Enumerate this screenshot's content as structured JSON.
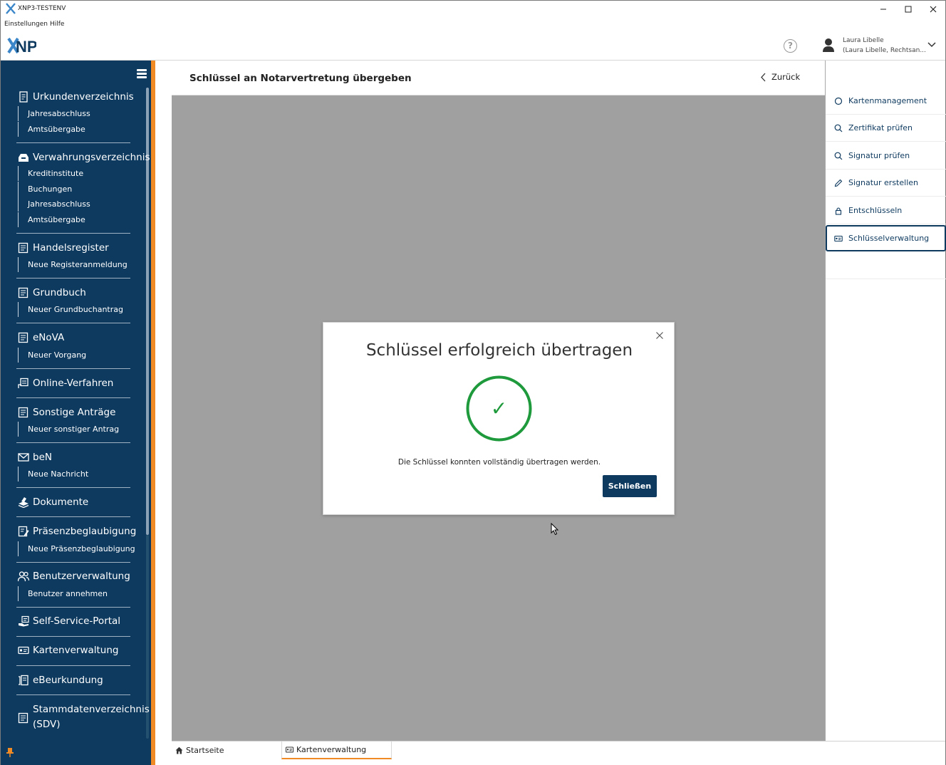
{
  "window": {
    "title": "XNP3-TESTENV",
    "minimize": "—",
    "maximize": "☐",
    "close": "✕"
  },
  "menu": {
    "settings": "Einstellungen",
    "help": "Hilfe"
  },
  "header": {
    "help_icon": "?",
    "user_name": "Laura Libelle",
    "user_role": "(Laura Libelle, Rechtsan..."
  },
  "sidebar": {
    "sections": [
      {
        "label": "Urkundenverzeichnis",
        "icon": "document-icon",
        "items": [
          "Jahresabschluss",
          "Amtsübergabe"
        ]
      },
      {
        "label": "Verwahrungsverzeichnis",
        "icon": "inbox-icon",
        "items": [
          "Kreditinstitute",
          "Buchungen",
          "Jahresabschluss",
          "Amtsübergabe"
        ]
      },
      {
        "label": "Handelsregister",
        "icon": "register-icon",
        "items": [
          "Neue Registeranmeldung"
        ]
      },
      {
        "label": "Grundbuch",
        "icon": "register-icon",
        "items": [
          "Neuer Grundbuchantrag"
        ]
      },
      {
        "label": "eNoVA",
        "icon": "register-icon",
        "items": [
          "Neuer Vorgang"
        ]
      },
      {
        "label": "Online-Verfahren",
        "icon": "online-icon",
        "items": []
      },
      {
        "label": "Sonstige Anträge",
        "icon": "register-icon",
        "items": [
          "Neuer sonstiger Antrag"
        ]
      },
      {
        "label": "beN",
        "icon": "mail-icon",
        "items": [
          "Neue Nachricht"
        ]
      },
      {
        "label": "Dokumente",
        "icon": "stack-icon",
        "items": []
      },
      {
        "label": "Präsenzbeglaubigung",
        "icon": "edit-document-icon",
        "items": [
          "Neue Präsenzbeglaubigung"
        ]
      },
      {
        "label": "Benutzerverwaltung",
        "icon": "users-icon",
        "items": [
          "Benutzer annehmen"
        ]
      },
      {
        "label": "Self-Service-Portal",
        "icon": "portal-icon",
        "items": []
      },
      {
        "label": "Kartenverwaltung",
        "icon": "card-icon",
        "items": []
      },
      {
        "label": "eBeurkundung",
        "icon": "ebeurkundung-icon",
        "items": []
      },
      {
        "label": "Stammdatenverzeichnis",
        "label2": "(SDV)",
        "icon": "register-icon",
        "items": []
      }
    ]
  },
  "page": {
    "title": "Schlüssel an Notarvertretung übergeben",
    "back_label": "Zurück"
  },
  "right_panel": {
    "items": [
      {
        "label": "Kartenmanagement",
        "icon": "circle-icon"
      },
      {
        "label": "Zertifikat prüfen",
        "icon": "search-icon"
      },
      {
        "label": "Signatur prüfen",
        "icon": "search-icon"
      },
      {
        "label": "Signatur erstellen",
        "icon": "pen-icon"
      },
      {
        "label": "Entschlüsseln",
        "icon": "lock-icon"
      },
      {
        "label": "Schlüsselverwaltung",
        "icon": "card-icon",
        "active": true
      }
    ]
  },
  "modal": {
    "title": "Schlüssel erfolgreich übertragen",
    "message": "Die Schlüssel konnten vollständig übertragen werden.",
    "close_button": "Schließen",
    "check_glyph": "✓",
    "accent_color": "#1e9a3c"
  },
  "bottom_tabs": [
    {
      "label": "Startseite",
      "icon": "home-icon"
    },
    {
      "label": "Kartenverwaltung",
      "icon": "card-icon",
      "active": true
    }
  ],
  "colors": {
    "sidebar_bg": "#0e3a5f",
    "accent_orange": "#f08a24",
    "overlay": "#a0a0a0",
    "primary": "#0e3a5f",
    "success": "#1e9a3c"
  }
}
